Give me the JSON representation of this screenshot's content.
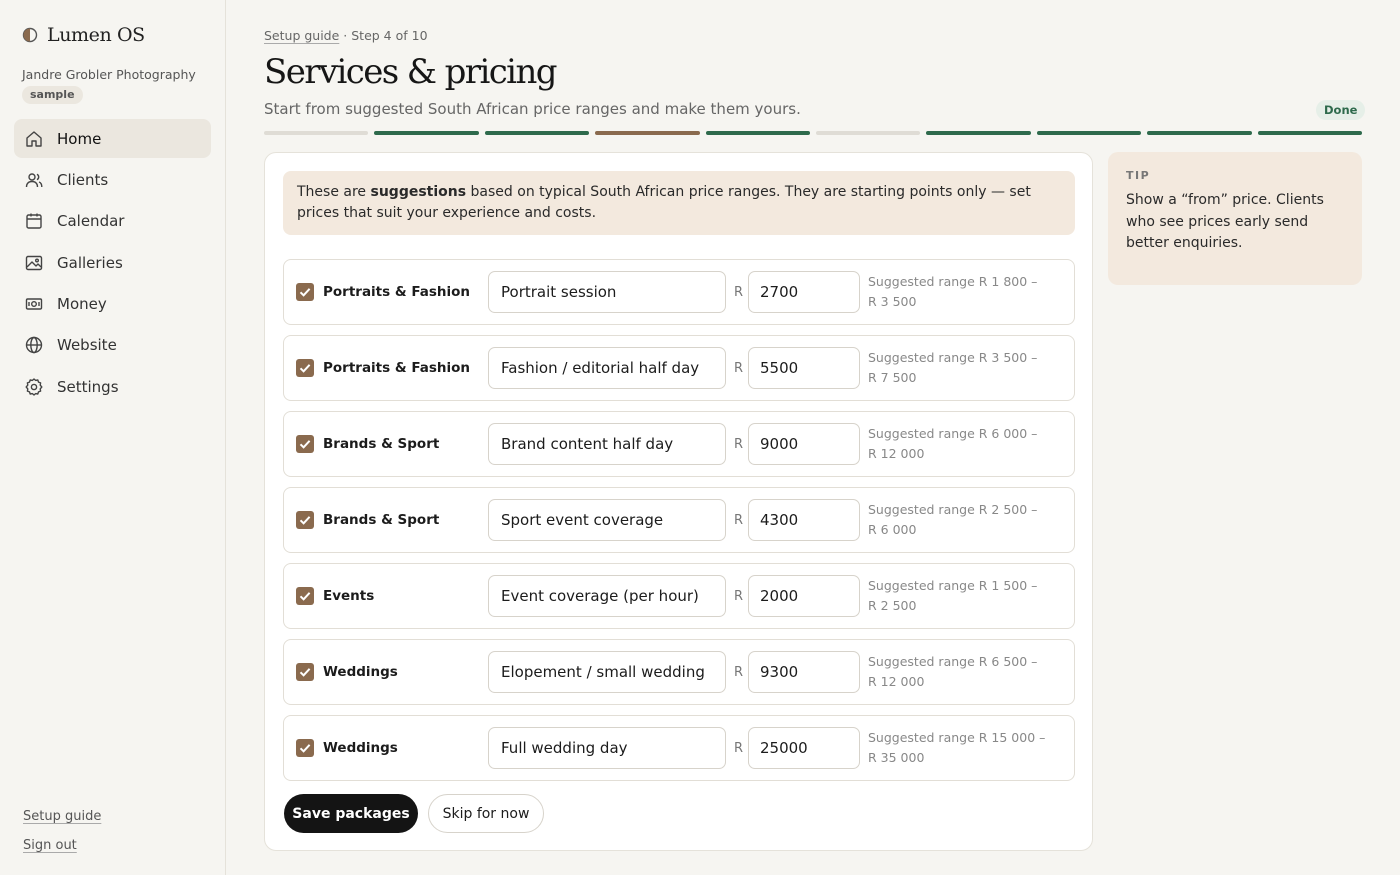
{
  "app": {
    "name": "Lumen OS",
    "studio": "Jandre Grobler Photography",
    "badge": "sample"
  },
  "sidebar": {
    "items": [
      {
        "label": "Home",
        "icon": "home-icon",
        "active": true
      },
      {
        "label": "Clients",
        "icon": "users-icon",
        "active": false
      },
      {
        "label": "Calendar",
        "icon": "calendar-icon",
        "active": false
      },
      {
        "label": "Galleries",
        "icon": "image-icon",
        "active": false
      },
      {
        "label": "Money",
        "icon": "banknote-icon",
        "active": false
      },
      {
        "label": "Website",
        "icon": "globe-icon",
        "active": false
      },
      {
        "label": "Settings",
        "icon": "gear-icon",
        "active": false
      }
    ],
    "footer": {
      "setup_guide": "Setup guide",
      "sign_out": "Sign out"
    }
  },
  "header": {
    "breadcrumb_link": "Setup guide",
    "breadcrumb_step": " · Step 4 of 10",
    "title": "Services & pricing",
    "subtitle": "Start from suggested South African price ranges and make them yours.",
    "status": "Done",
    "progress": {
      "total_steps": 10,
      "current_step": 4,
      "steps": [
        "todo",
        "done",
        "done",
        "current",
        "done",
        "todo",
        "done",
        "done",
        "done",
        "done"
      ]
    }
  },
  "notice": {
    "before": "These are ",
    "bold": "suggestions",
    "after": " based on typical South African price ranges. They are starting points only — set prices that suit your experience and costs."
  },
  "currency_symbol": "R",
  "packages": [
    {
      "checked": true,
      "category": "Portraits & Fashion",
      "name": "Portrait session",
      "price": "2700",
      "range_line1": "Suggested range R 1 800 –",
      "range_line2": "R 3 500"
    },
    {
      "checked": true,
      "category": "Portraits & Fashion",
      "name": "Fashion / editorial half day",
      "price": "5500",
      "range_line1": "Suggested range R 3 500 –",
      "range_line2": "R 7 500"
    },
    {
      "checked": true,
      "category": "Brands & Sport",
      "name": "Brand content half day",
      "price": "9000",
      "range_line1": "Suggested range R 6 000 –",
      "range_line2": "R 12 000"
    },
    {
      "checked": true,
      "category": "Brands & Sport",
      "name": "Sport event coverage",
      "price": "4300",
      "range_line1": "Suggested range R 2 500 –",
      "range_line2": "R 6 000"
    },
    {
      "checked": true,
      "category": "Events",
      "name": "Event coverage (per hour)",
      "price": "2000",
      "range_line1": "Suggested range R 1 500 –",
      "range_line2": "R 2 500"
    },
    {
      "checked": true,
      "category": "Weddings",
      "name": "Elopement / small wedding",
      "price": "9300",
      "range_line1": "Suggested range R 6 500 –",
      "range_line2": "R 12 000"
    },
    {
      "checked": true,
      "category": "Weddings",
      "name": "Full wedding day",
      "price": "25000",
      "range_line1": "Suggested range R 15 000 –",
      "range_line2": "R 35 000"
    }
  ],
  "actions": {
    "save": "Save packages",
    "skip": "Skip for now"
  },
  "tip": {
    "label": "TIP",
    "text": "Show a “from” price. Clients who see prices early send better enquiries."
  },
  "colors": {
    "accent_brown": "#8a6a4e",
    "progress_green": "#2e6a4c",
    "notice_bg": "#f3e9de",
    "primary_button": "#141414"
  }
}
